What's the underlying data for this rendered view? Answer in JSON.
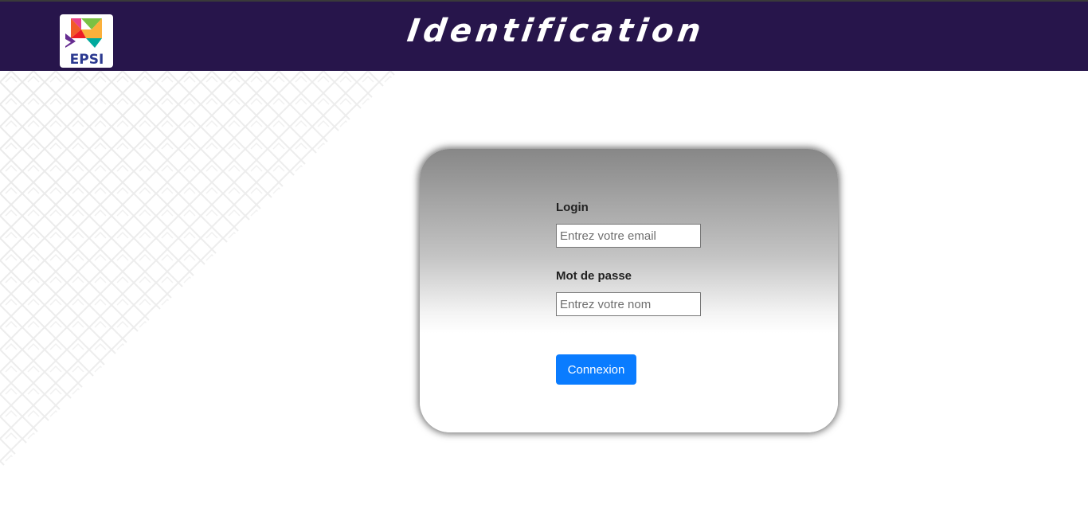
{
  "header": {
    "title": "Identification",
    "background_color": "#27154b",
    "logo_text": "EPSI"
  },
  "login_form": {
    "login_label": "Login",
    "login_placeholder": "Entrez votre email",
    "password_label": "Mot de passe",
    "password_placeholder": "Entrez votre nom",
    "submit_label": "Connexion",
    "submit_color": "#0a7cff"
  }
}
